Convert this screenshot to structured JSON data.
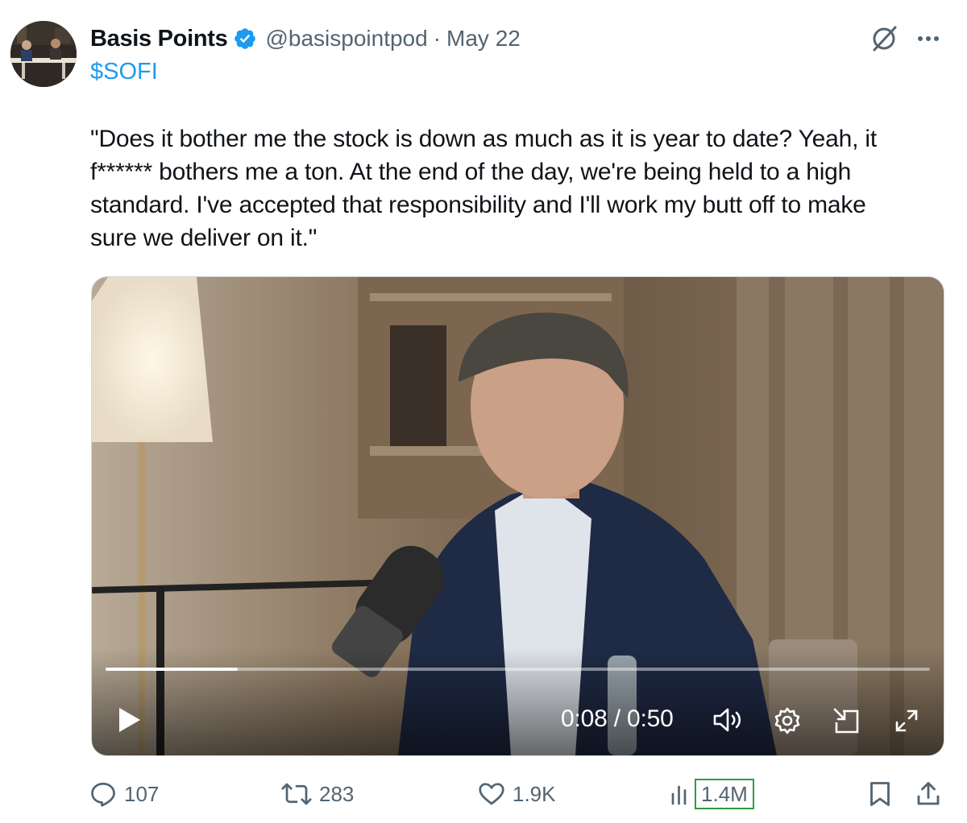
{
  "author": {
    "name": "Basis Points",
    "handle": "@basispointpod",
    "separator": "·",
    "date": "May 22",
    "verified_icon": "verified-badge-icon"
  },
  "cashtag": "$SOFI",
  "tweet_lines": [
    "\"Does it bother me the stock is down as much as it is year to date? Yeah, it",
    "f****** bothers me a ton. At the end of the day, we're being held to a high",
    "standard. I've accepted that responsibility and I'll work my butt off to make",
    "sure we deliver on it.\""
  ],
  "video": {
    "time": "0:08 / 0:50",
    "progress_fraction": 0.16
  },
  "actions": {
    "replies": "107",
    "retweets": "283",
    "likes": "1.9K",
    "views": "1.4M"
  },
  "colors": {
    "link": "#1d9bf0",
    "muted": "#536471",
    "views_highlight": "#2e9c42"
  }
}
